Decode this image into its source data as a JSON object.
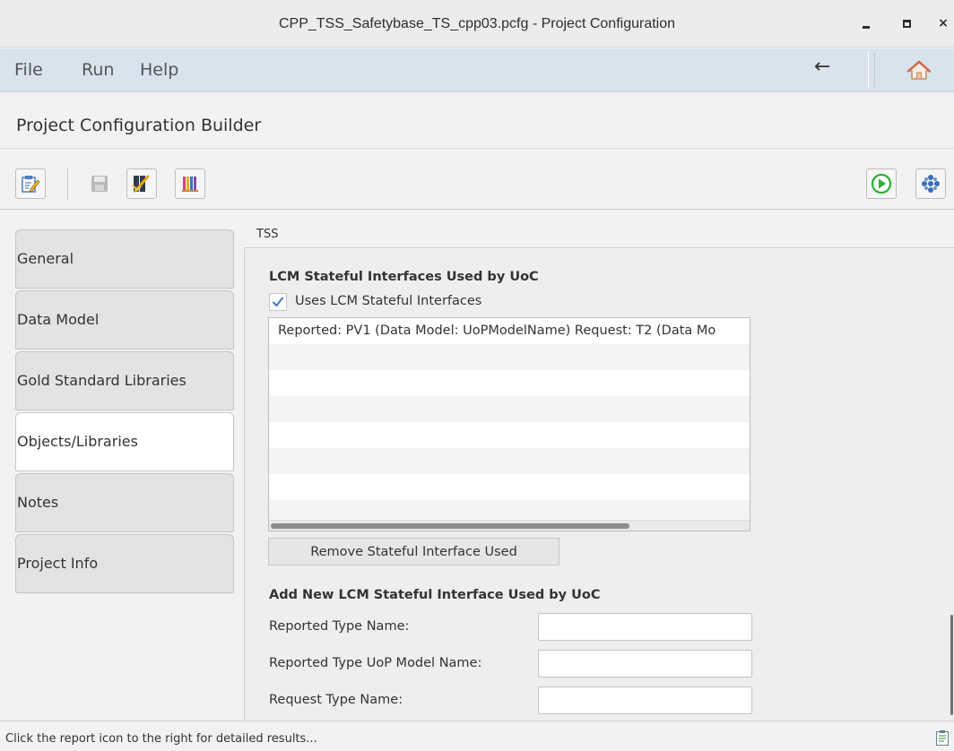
{
  "window": {
    "title": "CPP_TSS_Safetybase_TS_cpp03.pcfg - Project Configuration",
    "minimize_icon": "minimize-icon",
    "maximize_icon": "maximize-icon",
    "close_glyph": "×"
  },
  "menubar": {
    "items": [
      "File",
      "Run",
      "Help"
    ],
    "back_glyph": "←",
    "home_icon": "home-icon"
  },
  "header": {
    "title": "Project Configuration Builder"
  },
  "toolbar": {
    "icons": [
      "edit-config-icon",
      "save-icon",
      "validate-icon",
      "library-icon"
    ],
    "right_icons": [
      "run-icon",
      "settings-icon"
    ]
  },
  "sidebar": {
    "tabs": [
      {
        "label": "General",
        "active": false
      },
      {
        "label": "Data Model",
        "active": false
      },
      {
        "label": "Gold Standard Libraries",
        "active": false
      },
      {
        "label": "Objects/Libraries",
        "active": true
      },
      {
        "label": "Notes",
        "active": false
      },
      {
        "label": "Project Info",
        "active": false
      }
    ]
  },
  "panel": {
    "tab_label": "TSS",
    "section1_title": "LCM Stateful Interfaces Used by UoC",
    "checkbox_label": "Uses LCM Stateful Interfaces",
    "checkbox_checked": true,
    "list_items": [
      "Reported: PV1 (Data Model: UoPModelName) Request: T2 (Data Mo"
    ],
    "remove_button": "Remove Stateful Interface Used",
    "section2_title": "Add New LCM Stateful Interface Used by UoC",
    "fields": [
      {
        "label": "Reported Type Name:",
        "value": ""
      },
      {
        "label": "Reported Type UoP Model Name:",
        "value": ""
      },
      {
        "label": "Request Type Name:",
        "value": ""
      }
    ]
  },
  "status": {
    "message": "Click the report icon to the right for detailed results...",
    "report_icon": "report-icon"
  },
  "colors": {
    "menubar_bg": "#d9e3ee",
    "accent_check": "#3d7cc9",
    "run_green": "#2fae3b"
  }
}
